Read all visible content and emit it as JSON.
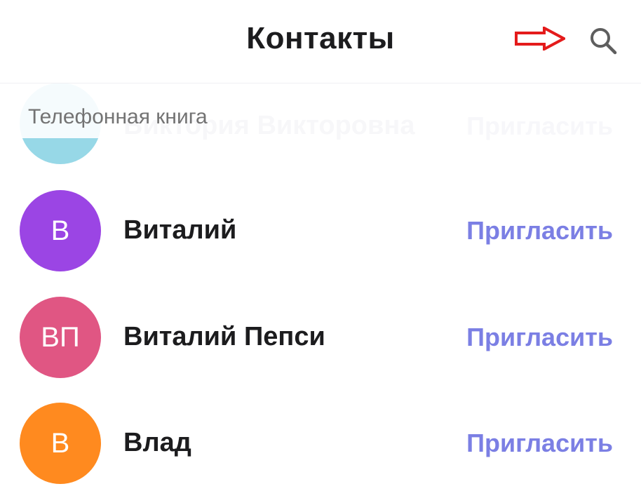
{
  "header": {
    "title": "Контакты"
  },
  "section": {
    "title": "Телефонная книга"
  },
  "contacts": [
    {
      "initials": "",
      "name": "Виктория Викторовна",
      "invite_label": "Пригласить",
      "color": "#19a8c9"
    },
    {
      "initials": "В",
      "name": "Виталий",
      "invite_label": "Пригласить",
      "color": "#9b45e4"
    },
    {
      "initials": "ВП",
      "name": "Виталий Пепси",
      "invite_label": "Пригласить",
      "color": "#e05683"
    },
    {
      "initials": "В",
      "name": "Влад",
      "invite_label": "Пригласить",
      "color": "#ff8a1f"
    }
  ],
  "colors": {
    "accent": "#7b7fe4",
    "annotation_arrow": "#e41b1b"
  },
  "icons": {
    "search": "search-icon",
    "annotation": "arrow-right-icon"
  }
}
